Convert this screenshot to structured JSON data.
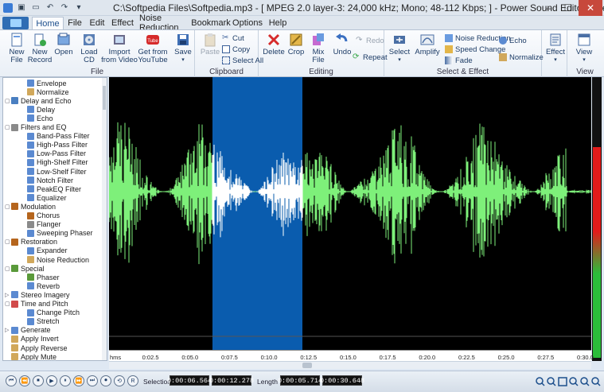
{
  "window": {
    "title": "C:\\Softpedia Files\\Softpedia.mp3 - [ MPEG 2.0 layer-3: 24,000 kHz; Mono; 48-112 Kbps;  ] - Power Sound Editor Free 8.2.1",
    "min": "–",
    "max": "☐",
    "close": "✕"
  },
  "quick_access": [
    "file-icon",
    "open-icon",
    "save-icon",
    "undo-icon",
    "redo-icon",
    "dropdown-icon"
  ],
  "tabs": [
    {
      "label": "Home",
      "active": true
    },
    {
      "label": "File"
    },
    {
      "label": "Edit"
    },
    {
      "label": "Effect"
    },
    {
      "label": "Noise Reduction"
    },
    {
      "label": "Bookmark"
    },
    {
      "label": "Options"
    },
    {
      "label": "Help"
    }
  ],
  "ribbon": {
    "file": {
      "label": "File",
      "buttons": [
        {
          "label": "New\nFile",
          "icon": "new-file-icon"
        },
        {
          "label": "New\nRecord",
          "icon": "record-icon"
        },
        {
          "label": "Open",
          "icon": "open-icon"
        },
        {
          "label": "Load\nCD",
          "icon": "cd-icon"
        },
        {
          "label": "Import\nfrom Video",
          "icon": "video-icon"
        },
        {
          "label": "Get from\nYouTube",
          "icon": "youtube-icon"
        },
        {
          "label": "Save",
          "icon": "save-icon"
        }
      ]
    },
    "clipboard": {
      "label": "Clipboard",
      "paste": "Paste",
      "cut": "Cut",
      "copy": "Copy",
      "select_all": "Select All"
    },
    "editing": {
      "label": "Editing",
      "buttons": [
        "Delete",
        "Crop",
        "Mix\nFile",
        "Undo"
      ],
      "redo": "Redo",
      "repeat": "Repeat"
    },
    "select_effect": {
      "label": "Select & Effect",
      "select": "Select",
      "amplify": "Amplify",
      "noise_reduction": "Noise Reduction",
      "speed_change": "Speed Change",
      "fade": "Fade",
      "echo": "Echo",
      "normalize": "Normalize",
      "effect": "Effect"
    },
    "view": {
      "label": "View",
      "view": "View"
    }
  },
  "tree": [
    {
      "label": "Envelope",
      "level": 2,
      "color": "#5b8ad1"
    },
    {
      "label": "Normalize",
      "level": 2,
      "color": "#d1a85b"
    },
    {
      "label": "Delay and Echo",
      "level": 1,
      "color": "#4a7fc1",
      "exp": "▢"
    },
    {
      "label": "Delay",
      "level": 2,
      "color": "#5b8ad1"
    },
    {
      "label": "Echo",
      "level": 2,
      "color": "#5b8ad1"
    },
    {
      "label": "Filters and EQ",
      "level": 1,
      "color": "#8a8a8a",
      "exp": "▢"
    },
    {
      "label": "Band-Pass Filter",
      "level": 2,
      "color": "#5b8ad1"
    },
    {
      "label": "High-Pass Filter",
      "level": 2,
      "color": "#5b8ad1"
    },
    {
      "label": "Low-Pass Filter",
      "level": 2,
      "color": "#5b8ad1"
    },
    {
      "label": "High-Shelf Filter",
      "level": 2,
      "color": "#5b8ad1"
    },
    {
      "label": "Low-Shelf Filter",
      "level": 2,
      "color": "#5b8ad1"
    },
    {
      "label": "Notch Filter",
      "level": 2,
      "color": "#5b8ad1"
    },
    {
      "label": "PeakEQ Filter",
      "level": 2,
      "color": "#5b8ad1"
    },
    {
      "label": "Equalizer",
      "level": 2,
      "color": "#5b8ad1"
    },
    {
      "label": "Modulation",
      "level": 1,
      "color": "#b5651d",
      "exp": "▢"
    },
    {
      "label": "Chorus",
      "level": 2,
      "color": "#b5651d"
    },
    {
      "label": "Flanger",
      "level": 2,
      "color": "#8a8a8a"
    },
    {
      "label": "Sweeping Phaser",
      "level": 2,
      "color": "#5b8ad1"
    },
    {
      "label": "Restoration",
      "level": 1,
      "color": "#b5651d",
      "exp": "▢"
    },
    {
      "label": "Expander",
      "level": 2,
      "color": "#5b8ad1"
    },
    {
      "label": "Noise Reduction",
      "level": 2,
      "color": "#d1a85b"
    },
    {
      "label": "Special",
      "level": 1,
      "color": "#5a9a3a",
      "exp": "▢"
    },
    {
      "label": "Phaser",
      "level": 2,
      "color": "#5a9a3a"
    },
    {
      "label": "Reverb",
      "level": 2,
      "color": "#5b8ad1"
    },
    {
      "label": "Stereo Imagery",
      "level": 1,
      "color": "#5b8ad1",
      "exp": "▷"
    },
    {
      "label": "Time and Pitch",
      "level": 1,
      "color": "#d14a4a",
      "exp": "▢"
    },
    {
      "label": "Change Pitch",
      "level": 2,
      "color": "#5b8ad1"
    },
    {
      "label": "Stretch",
      "level": 2,
      "color": "#5b8ad1"
    },
    {
      "label": "Generate",
      "level": 1,
      "color": "#5b8ad1",
      "exp": "▷"
    },
    {
      "label": "Apply Invert",
      "level": 1,
      "color": "#d1a85b"
    },
    {
      "label": "Apply Reverse",
      "level": 1,
      "color": "#d1a85b"
    },
    {
      "label": "Apply Mute",
      "level": 1,
      "color": "#d1a85b"
    }
  ],
  "ruler": [
    "hms",
    "0:02.5",
    "0:05.0",
    "0:07.5",
    "0:10.0",
    "0:12.5",
    "0:15.0",
    "0:17.5",
    "0:20.0",
    "0:22.5",
    "0:25.0",
    "0:27.5",
    "0:30.0"
  ],
  "colors": {
    "waveform": "#7ef07a",
    "selected_waveform": "#ffffff",
    "selection": "#0a5cae",
    "background": "#000000"
  },
  "transport": {
    "buttons": [
      "⏮",
      "⏪",
      "⏹",
      "▶",
      "⏸",
      "⏩",
      "⏭",
      "⏺",
      "⟲",
      "⏏",
      "⏮",
      "⏭",
      "R"
    ],
    "selection_label": "Selection",
    "selection_start": "0:00:06.564",
    "selection_end": "0:00:12.278",
    "length_label": "Length",
    "length_value": "0:00:05.714",
    "total_value": "0:00:30.648"
  },
  "zoom_icons": [
    "zoom-in-icon",
    "zoom-out-icon",
    "zoom-fit-icon",
    "zoom-selection-icon",
    "zoom-in-vertical-icon",
    "zoom-out-vertical-icon",
    "zoom-full-icon"
  ]
}
